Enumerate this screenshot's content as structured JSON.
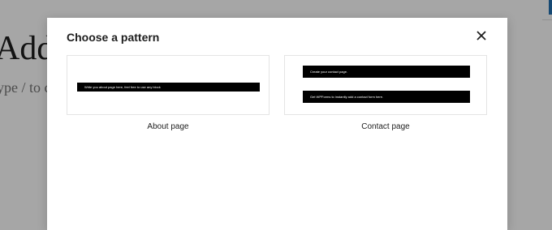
{
  "background": {
    "title": "Add",
    "placeholder": "ype / to ch"
  },
  "modal": {
    "title": "Choose a pattern",
    "close_icon": "close-icon"
  },
  "patterns": [
    {
      "label": "About page",
      "preview_lines": [
        "Write you about page here, feel free to use any block"
      ]
    },
    {
      "label": "Contact page",
      "preview_lines": [
        "Create your contact page.",
        "Get WPForms to instantly add a contact form here."
      ]
    }
  ],
  "colors": {
    "overlay": "rgba(0,0,0,0.35)",
    "accent": "#2271b1",
    "preview_bar": "#000000"
  }
}
